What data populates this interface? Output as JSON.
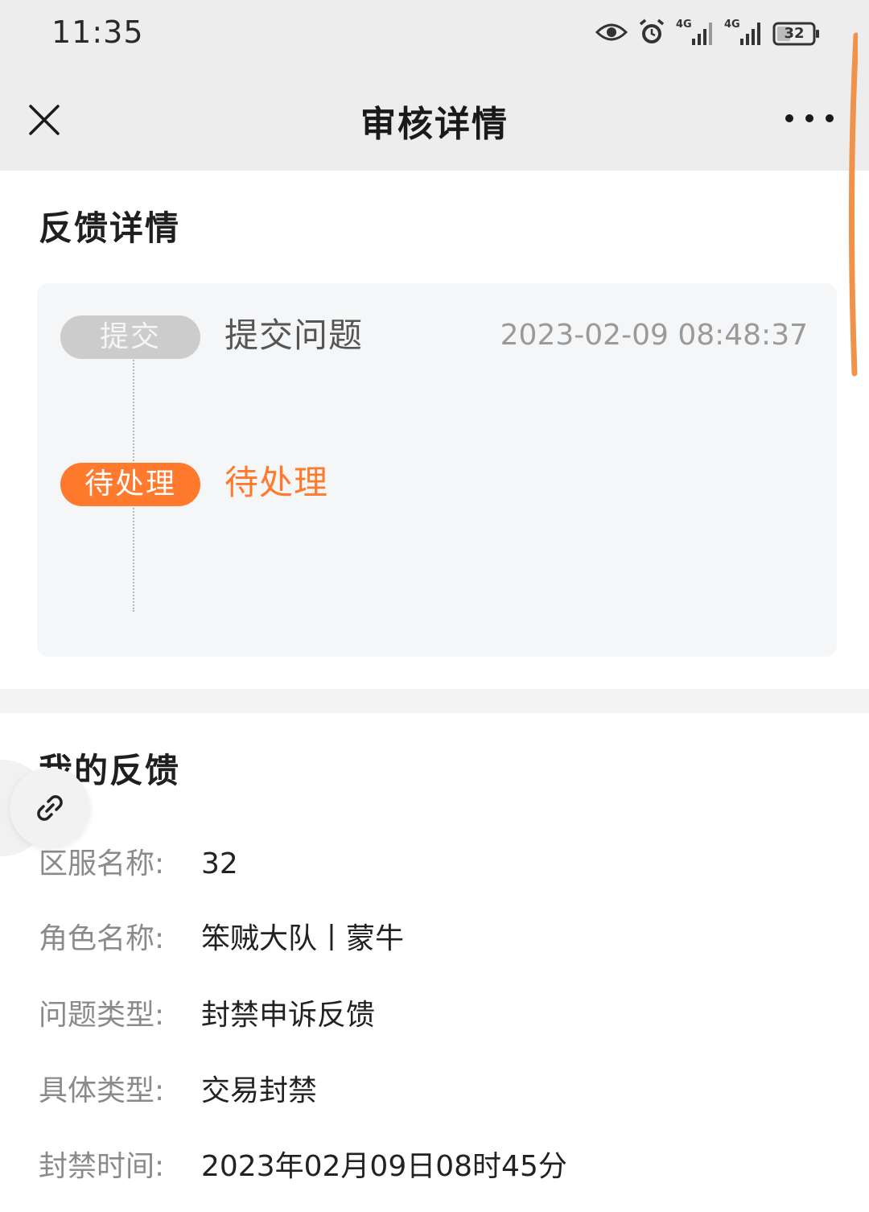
{
  "status_bar": {
    "time": "11:35",
    "battery": "32",
    "net1": "4G",
    "net2": "4G"
  },
  "header": {
    "title": "审核详情"
  },
  "feedback_details": {
    "title": "反馈详情",
    "steps": [
      {
        "badge": "提交",
        "label": "提交问题",
        "time": "2023-02-09 08:48:37",
        "state": "done"
      },
      {
        "badge": "待处理",
        "label": "待处理",
        "time": "",
        "state": "active"
      }
    ]
  },
  "my_feedback": {
    "title": "我的反馈",
    "rows": [
      {
        "label": "区服名称:",
        "value": "32"
      },
      {
        "label": "角色名称:",
        "value": "笨贼大队丨蒙牛"
      },
      {
        "label": "问题类型:",
        "value": "封禁申诉反馈"
      },
      {
        "label": "具体类型:",
        "value": "交易封禁"
      },
      {
        "label": "封禁时间:",
        "value": "2023年02月09日08时45分"
      }
    ]
  },
  "colors": {
    "accent": "#ff7a2c",
    "scroll_indicator": "#f0924a",
    "badge_inactive": "#cccccc"
  }
}
